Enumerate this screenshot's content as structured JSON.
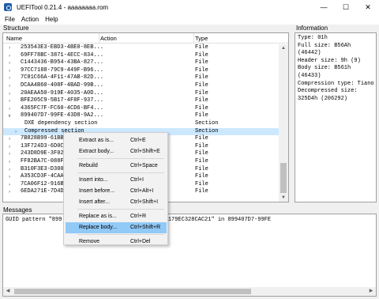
{
  "window": {
    "title": "UEFITool 0.21.4 - aaaaaaaa.rom"
  },
  "menu": [
    "File",
    "Action",
    "Help"
  ],
  "structure": {
    "label": "Structure",
    "columns": [
      "Name",
      "Action",
      "Type"
    ],
    "rows": [
      {
        "indent": 1,
        "expander": "collapsed",
        "name": "253543E3-EBD3-4BE0-8EB...",
        "type": "File"
      },
      {
        "indent": 1,
        "expander": "collapsed",
        "name": "69FF78BC-3871-4ECC-834...",
        "type": "File"
      },
      {
        "indent": 1,
        "expander": "collapsed",
        "name": "C1443436-B954-43BA-827...",
        "type": "File"
      },
      {
        "indent": 1,
        "expander": "collapsed",
        "name": "97CC7188-79C9-449F-B96...",
        "type": "File"
      },
      {
        "indent": 1,
        "expander": "collapsed",
        "name": "7C81C66A-4F11-47AB-82D...",
        "type": "File"
      },
      {
        "indent": 1,
        "expander": "collapsed",
        "name": "DCAA4B60-408F-4BAD-99B...",
        "type": "File"
      },
      {
        "indent": 1,
        "expander": "collapsed",
        "name": "20AEAA50-919E-4035-A0D...",
        "type": "File"
      },
      {
        "indent": 1,
        "expander": "collapsed",
        "name": "BFE205C9-5B17-4F8F-937...",
        "type": "File"
      },
      {
        "indent": 1,
        "expander": "collapsed",
        "name": "4365FC7F-FC60-4CD6-BF4...",
        "type": "File"
      },
      {
        "indent": 1,
        "expander": "expanded",
        "name": "899407D7-99FE-43D8-9A2...",
        "type": "File"
      },
      {
        "indent": 2,
        "expander": "",
        "name": "DXE dependency section",
        "type": "Section"
      },
      {
        "indent": 2,
        "expander": "collapsed",
        "name": "Compressed section",
        "type": "Section",
        "selected": true
      },
      {
        "indent": 1,
        "expander": "collapsed",
        "name": "7B828B99-61BB",
        "type": "File"
      },
      {
        "indent": 1,
        "expander": "collapsed",
        "name": "13F724D3-6D0C",
        "type": "File"
      },
      {
        "indent": 1,
        "expander": "collapsed",
        "name": "243D8D9E-3F02",
        "type": "File"
      },
      {
        "indent": 1,
        "expander": "collapsed",
        "name": "FF82BA7C-088F",
        "type": "File"
      },
      {
        "indent": 1,
        "expander": "collapsed",
        "name": "B310F3E3-D300",
        "type": "File"
      },
      {
        "indent": 1,
        "expander": "collapsed",
        "name": "A353CD3F-4CAA",
        "type": "File"
      },
      {
        "indent": 1,
        "expander": "collapsed",
        "name": "7CA06F12-916B",
        "type": "File"
      },
      {
        "indent": 1,
        "expander": "collapsed",
        "name": "6EDA271E-7D4D",
        "type": "File"
      }
    ]
  },
  "information": {
    "label": "Information",
    "lines": [
      "Type: 01h",
      "Full size: B56Ah",
      "(46442)",
      "Header size: 9h (9)",
      "Body size: B561h",
      "(46433)",
      "Compression type: Tiano",
      "Decompressed size:",
      "325D4h (206292)"
    ]
  },
  "messages": {
    "label": "Messages",
    "lines": [
      "GUID pattern \"899                                              \" found as \"D7079489FE99D8439A2179EC328CAC21\" in 899407D7-99FE"
    ]
  },
  "context_menu": {
    "items": [
      {
        "label": "Extract as is...",
        "shortcut": "Ctrl+E"
      },
      {
        "label": "Extract body...",
        "shortcut": "Ctrl+Shift+E"
      },
      {
        "label": "Rebuild",
        "shortcut": "Ctrl+Space"
      },
      {
        "label": "Insert into...",
        "shortcut": "Ctrl+I"
      },
      {
        "label": "Insert before...",
        "shortcut": "Ctrl+Alt+I"
      },
      {
        "label": "Insert after...",
        "shortcut": "Ctrl+Shift+I"
      },
      {
        "label": "Replace as is...",
        "shortcut": "Ctrl+R"
      },
      {
        "label": "Replace body...",
        "shortcut": "Ctrl+Shift+R",
        "highlighted": true
      },
      {
        "label": "Remove",
        "shortcut": "Ctrl+Del"
      }
    ]
  },
  "colors": {
    "selection": "#cce8ff",
    "menu_highlight": "#91c9f7",
    "app_icon": "#1c5fa8"
  }
}
